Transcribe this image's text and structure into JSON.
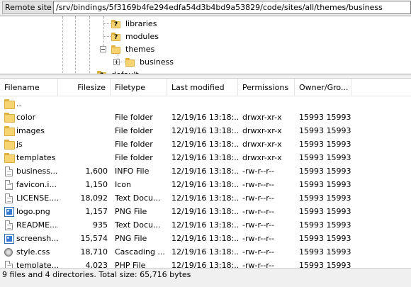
{
  "site_bar": {
    "label": "Remote site:",
    "path": "/srv/bindings/5f3169b4fe294edfa54d3b4bd9a53829/code/sites/all/themes/business"
  },
  "tree": {
    "items": [
      {
        "label": "libraries",
        "icon": "unknown-folder-icon"
      },
      {
        "label": "modules",
        "icon": "unknown-folder-icon"
      },
      {
        "label": "themes",
        "icon": "folder-icon"
      },
      {
        "label": "business",
        "icon": "folder-icon"
      },
      {
        "label": "default",
        "icon": "unknown-folder-icon"
      }
    ]
  },
  "list": {
    "columns": [
      "Filename",
      "Filesize",
      "Filetype",
      "Last modified",
      "Permissions",
      "Owner/Gro..."
    ],
    "rows": [
      {
        "name": "..",
        "size": "",
        "type": "",
        "modified": "",
        "perms": "",
        "owner": "",
        "icon": "folder-icon"
      },
      {
        "name": "color",
        "size": "",
        "type": "File folder",
        "modified": "12/19/16 13:18:...",
        "perms": "drwxr-xr-x",
        "owner": "15993 15993",
        "icon": "folder-icon"
      },
      {
        "name": "images",
        "size": "",
        "type": "File folder",
        "modified": "12/19/16 13:18:...",
        "perms": "drwxr-xr-x",
        "owner": "15993 15993",
        "icon": "folder-icon"
      },
      {
        "name": "js",
        "size": "",
        "type": "File folder",
        "modified": "12/19/16 13:18:...",
        "perms": "drwxr-xr-x",
        "owner": "15993 15993",
        "icon": "folder-icon"
      },
      {
        "name": "templates",
        "size": "",
        "type": "File folder",
        "modified": "12/19/16 13:18:...",
        "perms": "drwxr-xr-x",
        "owner": "15993 15993",
        "icon": "folder-icon"
      },
      {
        "name": "business....",
        "size": "1,600",
        "type": "INFO File",
        "modified": "12/19/16 13:18:...",
        "perms": "-rw-r--r--",
        "owner": "15993 15993",
        "icon": "document-icon"
      },
      {
        "name": "favicon.i...",
        "size": "1,150",
        "type": "Icon",
        "modified": "12/19/16 13:18:...",
        "perms": "-rw-r--r--",
        "owner": "15993 15993",
        "icon": "document-icon"
      },
      {
        "name": "LICENSE....",
        "size": "18,092",
        "type": "Text Docu...",
        "modified": "12/19/16 13:18:...",
        "perms": "-rw-r--r--",
        "owner": "15993 15993",
        "icon": "document-icon"
      },
      {
        "name": "logo.png",
        "size": "1,157",
        "type": "PNG File",
        "modified": "12/19/16 13:18:...",
        "perms": "-rw-r--r--",
        "owner": "15993 15993",
        "icon": "image-icon"
      },
      {
        "name": "README....",
        "size": "935",
        "type": "Text Docu...",
        "modified": "12/19/16 13:18:...",
        "perms": "-rw-r--r--",
        "owner": "15993 15993",
        "icon": "document-icon"
      },
      {
        "name": "screensh...",
        "size": "15,574",
        "type": "PNG File",
        "modified": "12/19/16 13:18:...",
        "perms": "-rw-r--r--",
        "owner": "15993 15993",
        "icon": "image-icon"
      },
      {
        "name": "style.css",
        "size": "18,710",
        "type": "Cascading ...",
        "modified": "12/19/16 13:18:...",
        "perms": "-rw-r--r--",
        "owner": "15993 15993",
        "icon": "css-file-icon"
      },
      {
        "name": "template....",
        "size": "4,023",
        "type": "PHP File",
        "modified": "12/19/16 13:18:...",
        "perms": "-rw-r--r--",
        "owner": "15993 15993",
        "icon": "document-icon"
      }
    ]
  },
  "status": {
    "text": "9 files and 4 directories. Total size: 65,716 bytes"
  }
}
